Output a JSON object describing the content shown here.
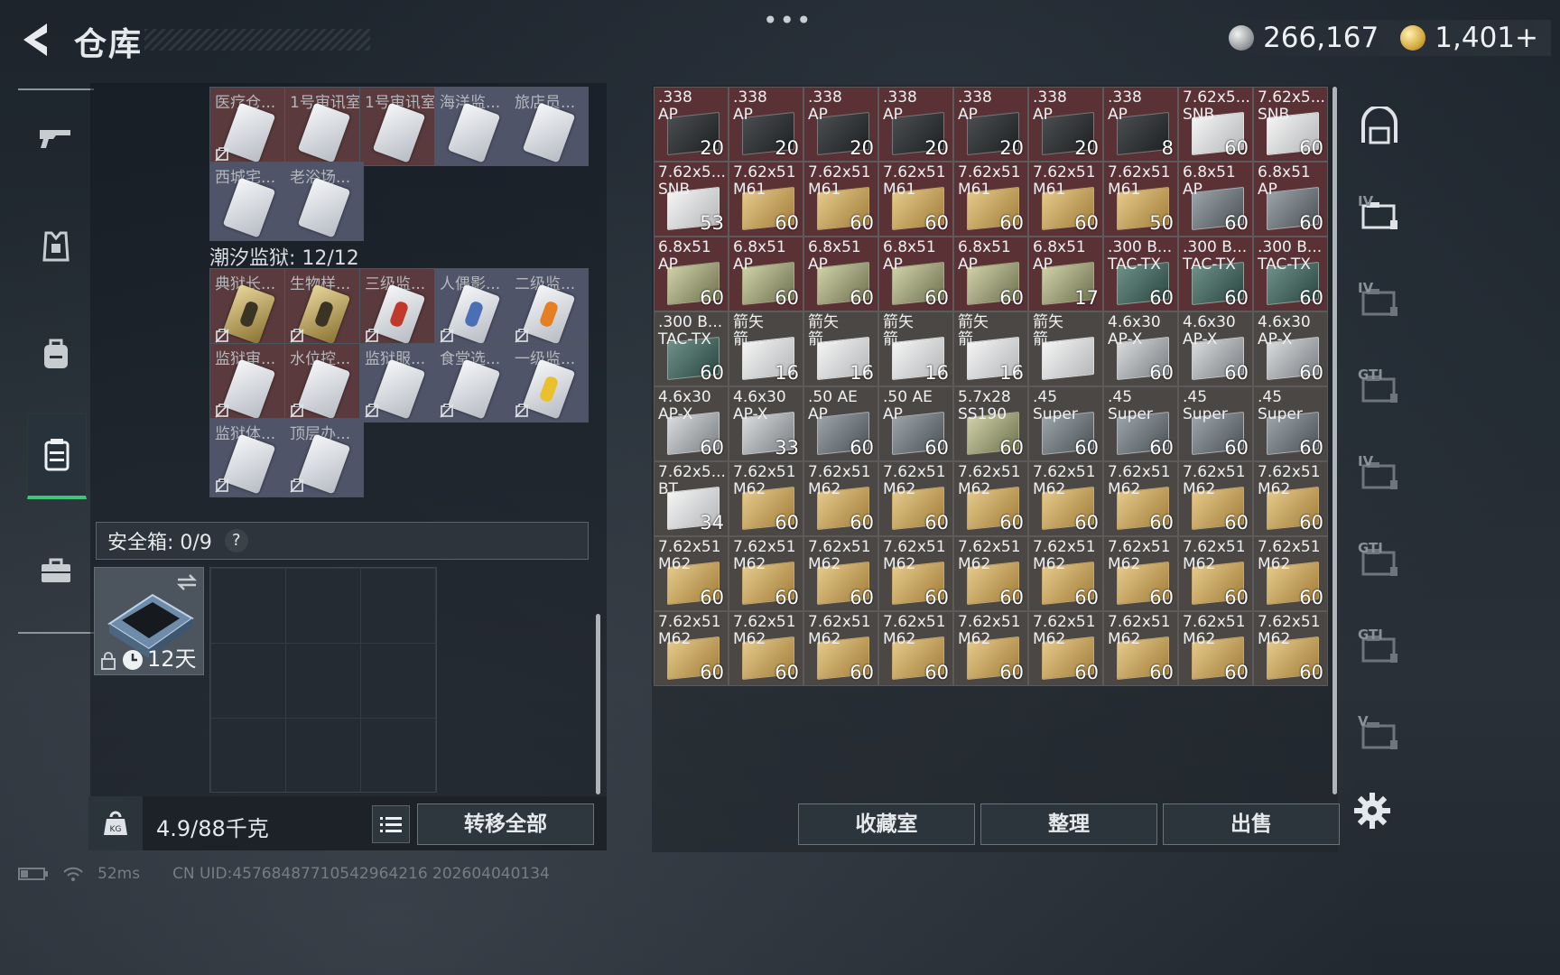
{
  "header": {
    "title": "仓库",
    "silver": "266,167",
    "gold": "1,401+"
  },
  "left_nav": [
    "gun-icon",
    "vest-icon",
    "backpack-icon",
    "case-icon",
    "briefcase-icon"
  ],
  "keycards_top": [
    {
      "name": "医疗仓...",
      "tone": "r",
      "card": "silver"
    },
    {
      "name": "1号审讯室",
      "tone": "r",
      "card": "silver"
    },
    {
      "name": "1号审讯室",
      "tone": "r",
      "card": "silver"
    },
    {
      "name": "海洋监...",
      "tone": "b",
      "card": "silver"
    },
    {
      "name": "旅店员...",
      "tone": "b",
      "card": "silver"
    },
    {
      "name": "西城宅...",
      "tone": "b",
      "card": "silver"
    },
    {
      "name": "老浴场...",
      "tone": "b",
      "card": "silver"
    }
  ],
  "prison_label": "潮汐监狱: 12/12",
  "keycards_prison": [
    {
      "name": "典狱长...",
      "tone": "r",
      "card": "gold"
    },
    {
      "name": "生物样...",
      "tone": "r",
      "card": "gold"
    },
    {
      "name": "三级监...",
      "tone": "r",
      "card": "red"
    },
    {
      "name": "人偶影...",
      "tone": "b",
      "card": "blue"
    },
    {
      "name": "二级监...",
      "tone": "b",
      "card": "orange"
    },
    {
      "name": "监狱审...",
      "tone": "r",
      "card": "silver"
    },
    {
      "name": "水位控...",
      "tone": "r",
      "card": "silver"
    },
    {
      "name": "监狱服...",
      "tone": "b",
      "card": "silver"
    },
    {
      "name": "食堂选...",
      "tone": "b",
      "card": "silver"
    },
    {
      "name": "一级监...",
      "tone": "b",
      "card": "yellow"
    },
    {
      "name": "监狱体...",
      "tone": "b",
      "card": "silver"
    },
    {
      "name": "顶层办...",
      "tone": "b",
      "card": "silver"
    }
  ],
  "safebox": {
    "label": "安全箱: 0/9",
    "help": "?",
    "timer": "12天"
  },
  "footer": {
    "weight": "4.9/88千克",
    "transfer_all": "转移全部",
    "ping": "52ms",
    "uid": "CN UID:4576848771054296421​6 202604040134"
  },
  "ammo": [
    {
      "l1": ".338",
      "l2": "AP",
      "count": "20",
      "bg": "red",
      "box": "dark"
    },
    {
      "l1": ".338",
      "l2": "AP",
      "count": "20",
      "bg": "red",
      "box": "dark"
    },
    {
      "l1": ".338",
      "l2": "AP",
      "count": "20",
      "bg": "red",
      "box": "dark"
    },
    {
      "l1": ".338",
      "l2": "AP",
      "count": "20",
      "bg": "red",
      "box": "dark"
    },
    {
      "l1": ".338",
      "l2": "AP",
      "count": "20",
      "bg": "red",
      "box": "dark"
    },
    {
      "l1": ".338",
      "l2": "AP",
      "count": "20",
      "bg": "red",
      "box": "dark"
    },
    {
      "l1": ".338",
      "l2": "AP",
      "count": "8",
      "bg": "red",
      "box": "dark"
    },
    {
      "l1": "7.62x5...",
      "l2": "SNB",
      "count": "60",
      "bg": "red",
      "box": "white"
    },
    {
      "l1": "7.62x5...",
      "l2": "SNB",
      "count": "60",
      "bg": "red",
      "box": "white"
    },
    {
      "l1": "7.62x5...",
      "l2": "SNB",
      "count": "53",
      "bg": "red",
      "box": "white"
    },
    {
      "l1": "7.62x51",
      "l2": "M61",
      "count": "60",
      "bg": "red",
      "box": "tan"
    },
    {
      "l1": "7.62x51",
      "l2": "M61",
      "count": "60",
      "bg": "red",
      "box": "tan"
    },
    {
      "l1": "7.62x51",
      "l2": "M61",
      "count": "60",
      "bg": "red",
      "box": "tan"
    },
    {
      "l1": "7.62x51",
      "l2": "M61",
      "count": "60",
      "bg": "red",
      "box": "tan"
    },
    {
      "l1": "7.62x51",
      "l2": "M61",
      "count": "60",
      "bg": "red",
      "box": "tan"
    },
    {
      "l1": "7.62x51",
      "l2": "M61",
      "count": "50",
      "bg": "red",
      "box": "tan"
    },
    {
      "l1": "6.8x51",
      "l2": "AP",
      "count": "60",
      "bg": "red",
      "box": "slate"
    },
    {
      "l1": "6.8x51",
      "l2": "AP",
      "count": "60",
      "bg": "red",
      "box": "slate"
    },
    {
      "l1": "6.8x51",
      "l2": "AP",
      "count": "60",
      "bg": "red",
      "box": "olive"
    },
    {
      "l1": "6.8x51",
      "l2": "AP",
      "count": "60",
      "bg": "red",
      "box": "olive"
    },
    {
      "l1": "6.8x51",
      "l2": "AP",
      "count": "60",
      "bg": "red",
      "box": "olive"
    },
    {
      "l1": "6.8x51",
      "l2": "AP",
      "count": "60",
      "bg": "red",
      "box": "olive"
    },
    {
      "l1": "6.8x51",
      "l2": "AP",
      "count": "60",
      "bg": "red",
      "box": "olive"
    },
    {
      "l1": "6.8x51",
      "l2": "AP",
      "count": "17",
      "bg": "red",
      "box": "olive"
    },
    {
      "l1": ".300 B...",
      "l2": "TAC-TX",
      "count": "60",
      "bg": "red",
      "box": "teal"
    },
    {
      "l1": ".300 B...",
      "l2": "TAC-TX",
      "count": "60",
      "bg": "red",
      "box": "teal"
    },
    {
      "l1": ".300 B...",
      "l2": "TAC-TX",
      "count": "60",
      "bg": "red",
      "box": "teal"
    },
    {
      "l1": ".300 B...",
      "l2": "TAC-TX",
      "count": "60",
      "bg": "gray",
      "box": "teal"
    },
    {
      "l1": "箭矢",
      "l2": "箭...",
      "count": "16",
      "bg": "gray",
      "box": "white"
    },
    {
      "l1": "箭矢",
      "l2": "箭...",
      "count": "16",
      "bg": "gray",
      "box": "white"
    },
    {
      "l1": "箭矢",
      "l2": "箭...",
      "count": "16",
      "bg": "gray",
      "box": "white"
    },
    {
      "l1": "箭矢",
      "l2": "箭...",
      "count": "16",
      "bg": "gray",
      "box": "white"
    },
    {
      "l1": "箭矢",
      "l2": "箭...",
      "count": "",
      "bg": "gray",
      "box": "white"
    },
    {
      "l1": "4.6x30",
      "l2": "AP-X",
      "count": "60",
      "bg": "gray",
      "box": "silver"
    },
    {
      "l1": "4.6x30",
      "l2": "AP-X",
      "count": "60",
      "bg": "gray",
      "box": "silver"
    },
    {
      "l1": "4.6x30",
      "l2": "AP-X",
      "count": "60",
      "bg": "gray",
      "box": "silver"
    },
    {
      "l1": "4.6x30",
      "l2": "AP-X",
      "count": "60",
      "bg": "gray",
      "box": "silver"
    },
    {
      "l1": "4.6x30",
      "l2": "AP-X",
      "count": "33",
      "bg": "gray",
      "box": "silver"
    },
    {
      "l1": ".50 AE",
      "l2": "AP",
      "count": "60",
      "bg": "gray",
      "box": "slate"
    },
    {
      "l1": ".50 AE",
      "l2": "AP",
      "count": "60",
      "bg": "gray",
      "box": "slate"
    },
    {
      "l1": "5.7x28",
      "l2": "SS190",
      "count": "60",
      "bg": "gray",
      "box": "olive"
    },
    {
      "l1": ".45",
      "l2": "Super",
      "count": "60",
      "bg": "gray",
      "box": "slate"
    },
    {
      "l1": ".45",
      "l2": "Super",
      "count": "60",
      "bg": "gray",
      "box": "slate"
    },
    {
      "l1": ".45",
      "l2": "Super",
      "count": "60",
      "bg": "gray",
      "box": "slate"
    },
    {
      "l1": ".45",
      "l2": "Super",
      "count": "60",
      "bg": "gray",
      "box": "slate"
    },
    {
      "l1": "7.62x5...",
      "l2": "BT",
      "count": "34",
      "bg": "gray",
      "box": "white"
    },
    {
      "l1": "7.62x51",
      "l2": "M62",
      "count": "60",
      "bg": "gray",
      "box": "tan"
    },
    {
      "l1": "7.62x51",
      "l2": "M62",
      "count": "60",
      "bg": "gray",
      "box": "tan"
    },
    {
      "l1": "7.62x51",
      "l2": "M62",
      "count": "60",
      "bg": "gray",
      "box": "tan"
    },
    {
      "l1": "7.62x51",
      "l2": "M62",
      "count": "60",
      "bg": "gray",
      "box": "tan"
    },
    {
      "l1": "7.62x51",
      "l2": "M62",
      "count": "60",
      "bg": "gray",
      "box": "tan"
    },
    {
      "l1": "7.62x51",
      "l2": "M62",
      "count": "60",
      "bg": "gray",
      "box": "tan"
    },
    {
      "l1": "7.62x51",
      "l2": "M62",
      "count": "60",
      "bg": "gray",
      "box": "tan"
    },
    {
      "l1": "7.62x51",
      "l2": "M62",
      "count": "60",
      "bg": "gray",
      "box": "tan"
    },
    {
      "l1": "7.62x51",
      "l2": "M62",
      "count": "60",
      "bg": "gray",
      "box": "tan"
    },
    {
      "l1": "7.62x51",
      "l2": "M62",
      "count": "60",
      "bg": "gray",
      "box": "tan"
    },
    {
      "l1": "7.62x51",
      "l2": "M62",
      "count": "60",
      "bg": "gray",
      "box": "tan"
    },
    {
      "l1": "7.62x51",
      "l2": "M62",
      "count": "60",
      "bg": "gray",
      "box": "tan"
    },
    {
      "l1": "7.62x51",
      "l2": "M62",
      "count": "60",
      "bg": "gray",
      "box": "tan"
    },
    {
      "l1": "7.62x51",
      "l2": "M62",
      "count": "60",
      "bg": "gray",
      "box": "tan"
    },
    {
      "l1": "7.62x51",
      "l2": "M62",
      "count": "60",
      "bg": "gray",
      "box": "tan"
    },
    {
      "l1": "7.62x51",
      "l2": "M62",
      "count": "60",
      "bg": "gray",
      "box": "tan"
    },
    {
      "l1": "7.62x51",
      "l2": "M62",
      "count": "60",
      "bg": "gray",
      "box": "tan"
    },
    {
      "l1": "7.62x51",
      "l2": "M62",
      "count": "60",
      "bg": "gray",
      "box": "tan"
    },
    {
      "l1": "7.62x51",
      "l2": "M62",
      "count": "60",
      "bg": "gray",
      "box": "tan"
    },
    {
      "l1": "7.62x51",
      "l2": "M62",
      "count": "60",
      "bg": "gray",
      "box": "tan"
    },
    {
      "l1": "7.62x51",
      "l2": "M62",
      "count": "60",
      "bg": "gray",
      "box": "tan"
    },
    {
      "l1": "7.62x51",
      "l2": "M62",
      "count": "60",
      "bg": "gray",
      "box": "tan"
    },
    {
      "l1": "7.62x51",
      "l2": "M62",
      "count": "60",
      "bg": "gray",
      "box": "tan"
    },
    {
      "l1": "7.62x51",
      "l2": "M62",
      "count": "60",
      "bg": "gray",
      "box": "tan"
    },
    {
      "l1": "7.62x51",
      "l2": "M62",
      "count": "60",
      "bg": "gray",
      "box": "tan"
    },
    {
      "l1": "7.62x51",
      "l2": "M62",
      "count": "60",
      "bg": "gray",
      "box": "tan"
    }
  ],
  "actions": {
    "collection": "收藏室",
    "sort": "整理",
    "sell": "出售"
  },
  "right_nav": [
    {
      "icon": "vault-icon",
      "label": ""
    },
    {
      "icon": "folder-iv-icon",
      "label": "IV"
    },
    {
      "icon": "folder-iv-dim-icon",
      "label": "IV"
    },
    {
      "icon": "gti-rack-icon",
      "label": "GTI"
    },
    {
      "icon": "iv-add-icon",
      "label": "IV"
    },
    {
      "icon": "gti-case-icon",
      "label": "GTI"
    },
    {
      "icon": "gti-rack2-icon",
      "label": "GTI"
    },
    {
      "icon": "v-folder-icon",
      "label": "V"
    }
  ]
}
